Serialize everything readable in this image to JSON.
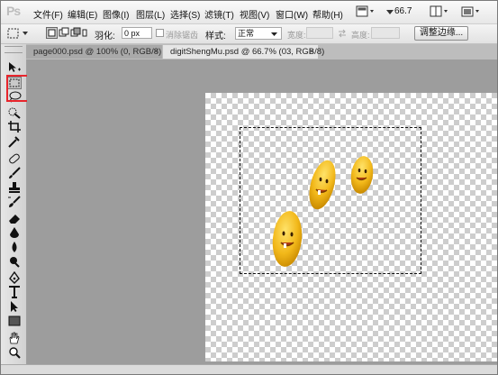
{
  "app": {
    "logo": "Ps"
  },
  "menu": {
    "items": [
      "文件(F)",
      "编辑(E)",
      "图像(I)",
      "图层(L)",
      "选择(S)",
      "滤镜(T)",
      "视图(V)",
      "窗口(W)",
      "帮助(H)"
    ],
    "zoom": "66.7"
  },
  "options": {
    "feather_label": "羽化:",
    "feather_value": "0 px",
    "antialias_label": "消除锯齿",
    "style_label": "样式:",
    "style_value": "正常",
    "width_label": "宽度:",
    "height_label": "高度:",
    "refine_edge_label": "调整边缘..."
  },
  "tabs": [
    {
      "label": "page000.psd @ 100% (0, RGB/8) *",
      "close": "×"
    },
    {
      "label": "digitShengMu.psd @ 66.7% (03, RGB/8)",
      "close": "×"
    }
  ],
  "tools": [
    "move-icon",
    "rectangular-marquee-icon",
    "lasso-icon",
    "quick-selection-icon",
    "crop-icon",
    "eyedropper-icon",
    "spot-healing-icon",
    "brush-icon",
    "clone-stamp-icon",
    "history-brush-icon",
    "eraser-icon",
    "gradient-icon",
    "blur-icon",
    "dodge-icon",
    "pen-icon",
    "type-icon",
    "path-selection-icon",
    "rectangle-shape-icon",
    "hand-icon",
    "zoom-icon"
  ],
  "colors": {
    "highlight": "#e8252c",
    "egg": "#f2b81a"
  }
}
